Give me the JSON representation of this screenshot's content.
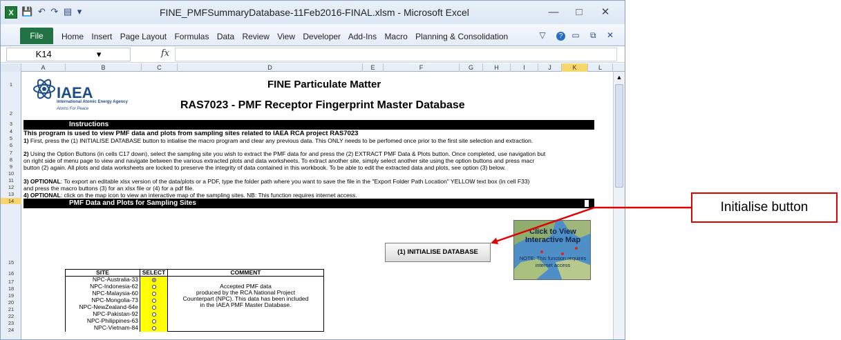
{
  "window": {
    "title": "FINE_PMFSummaryDatabase-11Feb2016-FINAL.xlsm  -  Microsoft Excel",
    "app_icon_label": "X"
  },
  "ribbon": {
    "file_tab": "File",
    "tabs": [
      "Home",
      "Insert",
      "Page Layout",
      "Formulas",
      "Data",
      "Review",
      "View",
      "Developer",
      "Add-Ins",
      "Macro",
      "Planning & Consolidation"
    ]
  },
  "formula_bar": {
    "name_box": "K14",
    "fx_label": "fx",
    "value": ""
  },
  "columns": [
    "A",
    "B",
    "C",
    "D",
    "E",
    "F",
    "G",
    "H",
    "I",
    "J",
    "K",
    "L"
  ],
  "rows": [
    "1",
    "2",
    "3",
    "4",
    "5",
    "6",
    "7",
    "8",
    "9",
    "10",
    "11",
    "12",
    "13",
    "14",
    "15",
    "16",
    "17",
    "18",
    "19",
    "20",
    "21",
    "22",
    "23",
    "24"
  ],
  "logo": {
    "name": "IAEA",
    "subtitle": "International Atomic Energy Agency",
    "motto": "Atoms For Peace"
  },
  "sheet": {
    "title1": "FINE Particulate Matter",
    "title2": "RAS7023 - PMF Receptor Fingerprint Master Database",
    "instructions_header": "Instructions",
    "line4": "This program is used to view PMF data and plots from sampling sites related to IAEA RCA project RAS7023",
    "line5_bold": "1)",
    "line5": " First, press the (1) INITIALISE DATABASE button to intialise the macro program and clear any previous data. This ONLY needs to be perfomed once prior to the first site selection and extraction.",
    "line7_bold": "2)",
    "line7": " Using the Option Buttons (in cells C17 down), select the sampling site you wish to extract the PMF data for and press the (2) EXTRACT PMF Data & Plots button. Once completed, use navigation but",
    "line8": " on right side of menu page to view and navigate between the various extracted plots and data worksheets. To extract another site, simply select another site using the option buttons and press macr",
    "line9": "button (2) again. All plots and data worksheets are locked to preserve the integrity of data contained in this workbook. To be able to edit the extracted data and plots, see option (3) below.",
    "line11_bold": "3) OPTIONAL",
    "line11": ": To export an editable xlsx version of the data/plots or a PDF, type the folder path where you want to save the file in the \"Export Folder Path Location\" YELLOW text box (in cell F33)",
    "line12": " and press the macro buttons (3) for an xlsx file or (4) for a pdf file.",
    "line13_bold": "4) OPTIONAL",
    "line13": ": click on the map icon to view an interactive map of the sampling sites. NB: This function requires internet access.",
    "section_header": "PMF Data and Plots for Sampling Sites",
    "init_button": "(1) INITIALISE DATABASE",
    "map_title": "Click to View Interactive Map",
    "map_note": "NOTE: This function requires internet access"
  },
  "site_table": {
    "headers": [
      "SITE",
      "SELECT",
      "COMMENT"
    ],
    "sites": [
      "NPC-Australia-33",
      "NPC-Indonesia-62",
      "NPC-Malaysia-60",
      "NPC-Mongolia-73",
      "NPC-NewZealand-64e",
      "NPC-Pakistan-92",
      "NPC-Philippines-63",
      "NPC-Vietnam-84"
    ],
    "selected_index": 0,
    "comment_lines": [
      "Accepted PMF data",
      "produced by the RCA National Project",
      "Counterpart (NPC). This data has been included",
      "in the IAEA PMF Master Database."
    ]
  },
  "callout": {
    "label": "Initialise button"
  },
  "colors": {
    "callout_border": "#e00000",
    "select_fill": "#ffff00",
    "excel_green": "#217346"
  }
}
